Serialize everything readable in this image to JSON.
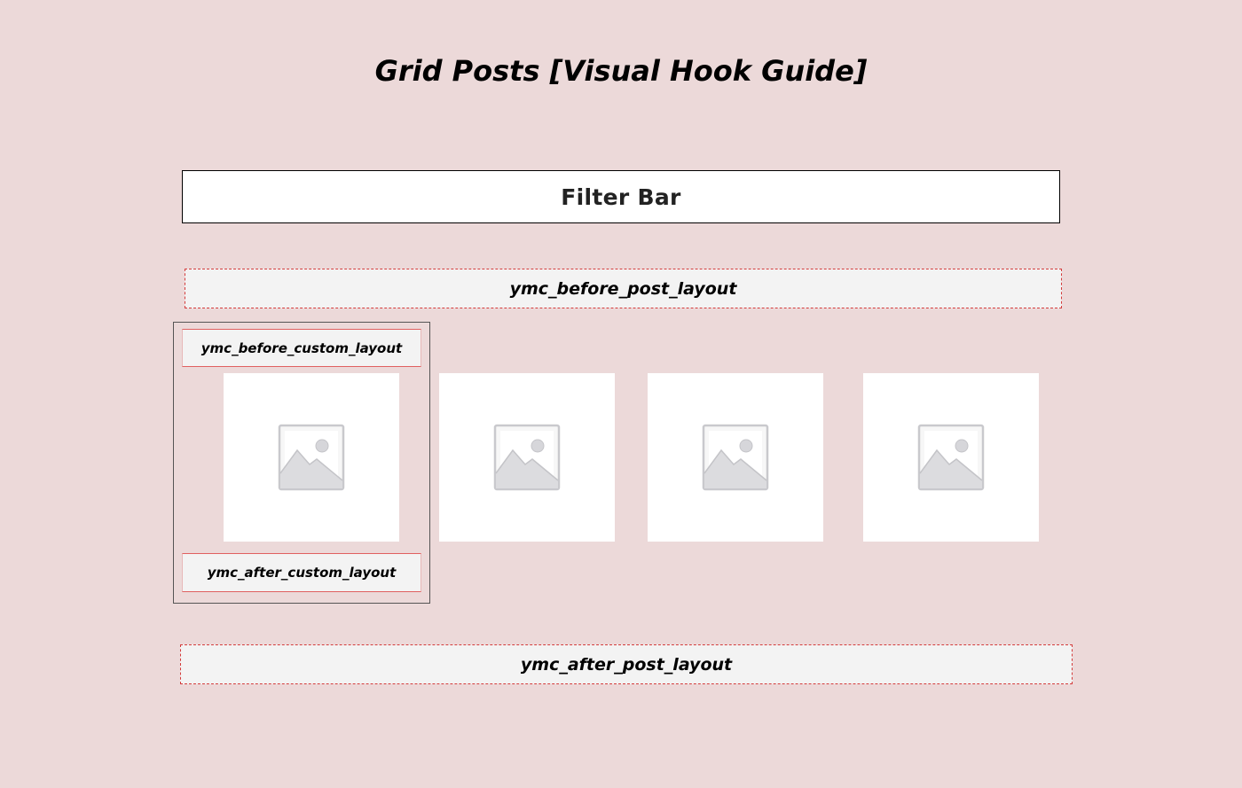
{
  "page": {
    "title": "Grid Posts [Visual Hook Guide]"
  },
  "filter_bar": {
    "label": "Filter Bar"
  },
  "hooks": {
    "before_post_layout": "ymc_before_post_layout",
    "after_post_layout": "ymc_after_post_layout",
    "before_custom_layout": "ymc_before_custom_layout",
    "after_custom_layout": "ymc_after_custom_layout"
  },
  "posts": [
    {
      "icon": "image-placeholder-icon"
    },
    {
      "icon": "image-placeholder-icon"
    },
    {
      "icon": "image-placeholder-icon"
    },
    {
      "icon": "image-placeholder-icon"
    }
  ],
  "colors": {
    "background": "#ecd9d9",
    "hook_fill": "#f3f3f3",
    "hook_border": "#d43c3c",
    "card_fill": "#ffffff"
  }
}
